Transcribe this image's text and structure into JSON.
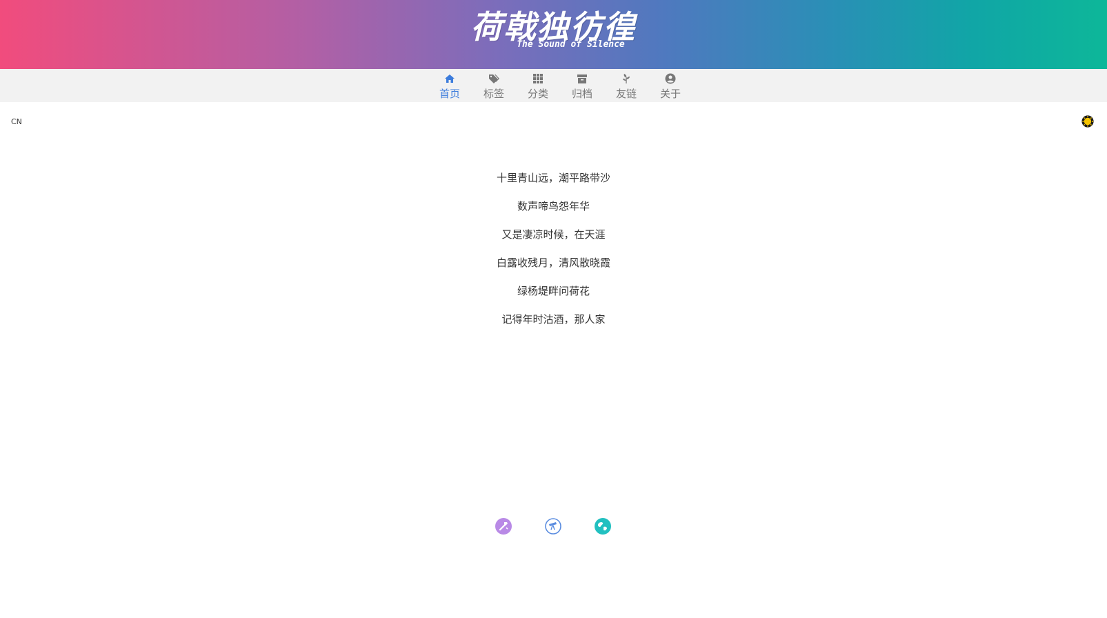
{
  "header": {
    "title": "荷戟独彷徨",
    "subtitle": "The Sound of Silence"
  },
  "nav": {
    "items": [
      {
        "label": "首页",
        "icon": "home-icon",
        "active": true
      },
      {
        "label": "标签",
        "icon": "tags-icon",
        "active": false
      },
      {
        "label": "分类",
        "icon": "grid-icon",
        "active": false
      },
      {
        "label": "归档",
        "icon": "archive-icon",
        "active": false
      },
      {
        "label": "友链",
        "icon": "leaf-icon",
        "active": false
      },
      {
        "label": "关于",
        "icon": "user-circle-icon",
        "active": false
      }
    ],
    "active_color": "#3c7cdc",
    "inactive_color": "#777777"
  },
  "lang_switch": "CN",
  "theme_toggle_icon": "sun-icon",
  "poem": {
    "lines": [
      "十里青山远，潮平路带沙",
      "数声啼鸟怨年华",
      "又是凄凉时候，在天涯",
      "白露收残月，清风散晓霞",
      "绿杨堤畔问荷花",
      "记得年时沽酒，那人家"
    ]
  },
  "footer": {
    "icons": [
      {
        "icon": "tools-icon",
        "color": "#b98ae6"
      },
      {
        "icon": "telescope-icon",
        "color": "#5b8de0"
      },
      {
        "icon": "globe-icon",
        "color": "#22c0c0"
      }
    ]
  }
}
